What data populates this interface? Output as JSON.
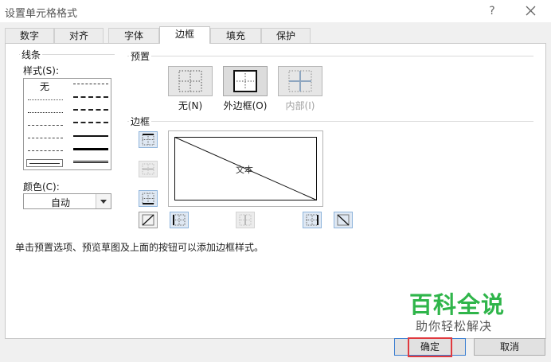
{
  "window": {
    "title": "设置单元格格式",
    "help": "?"
  },
  "tabs": [
    {
      "label": "数字"
    },
    {
      "label": "对齐"
    },
    {
      "label": "字体"
    },
    {
      "label": "边框",
      "active": true
    },
    {
      "label": "填充"
    },
    {
      "label": "保护"
    }
  ],
  "line": {
    "group_label": "线条",
    "style_label": "样式(S):",
    "none_label": "无",
    "color_label": "颜色(C):",
    "color_value": "自动"
  },
  "presets": {
    "group_label": "预置",
    "items": [
      {
        "label": "无(N)"
      },
      {
        "label": "外边框(O)"
      },
      {
        "label": "内部(I)",
        "disabled": true
      }
    ]
  },
  "border": {
    "group_label": "边框",
    "preview_text": "文本"
  },
  "hint": "单击预置选项、预览草图及上面的按钮可以添加边框样式。",
  "buttons": {
    "ok": "确定",
    "cancel": "取消"
  },
  "watermark": {
    "main": "百科全说",
    "sub": "助你轻松解决"
  },
  "colors": {
    "accent": "#3c7fd1",
    "highlight": "#e0393e",
    "watermark": "#2fb54a"
  }
}
